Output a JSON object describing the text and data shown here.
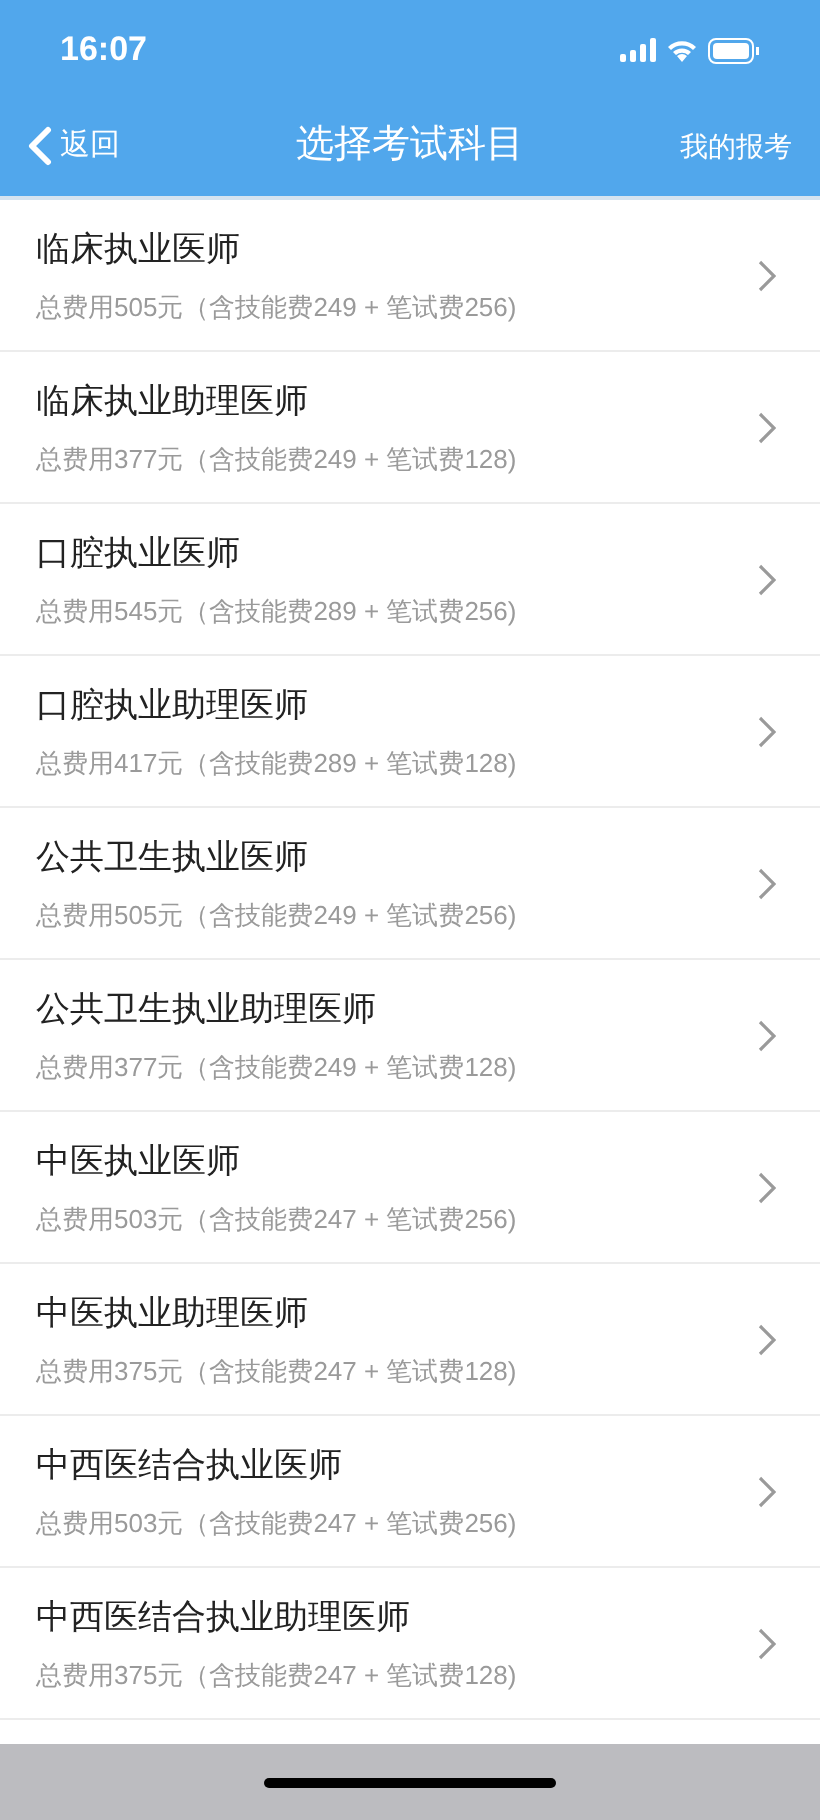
{
  "status_bar": {
    "time": "16:07"
  },
  "nav": {
    "back": "返回",
    "title": "选择考试科目",
    "action": "我的报考"
  },
  "subjects": [
    {
      "name": "临床执业医师",
      "fee": "总费用505元（含技能费249 + 笔试费256)"
    },
    {
      "name": "临床执业助理医师",
      "fee": "总费用377元（含技能费249 + 笔试费128)"
    },
    {
      "name": "口腔执业医师",
      "fee": "总费用545元（含技能费289 + 笔试费256)"
    },
    {
      "name": "口腔执业助理医师",
      "fee": "总费用417元（含技能费289 + 笔试费128)"
    },
    {
      "name": "公共卫生执业医师",
      "fee": "总费用505元（含技能费249 + 笔试费256)"
    },
    {
      "name": "公共卫生执业助理医师",
      "fee": "总费用377元（含技能费249 + 笔试费128)"
    },
    {
      "name": "中医执业医师",
      "fee": "总费用503元（含技能费247 + 笔试费256)"
    },
    {
      "name": "中医执业助理医师",
      "fee": "总费用375元（含技能费247 + 笔试费128)"
    },
    {
      "name": "中西医结合执业医师",
      "fee": "总费用503元（含技能费247 + 笔试费256)"
    },
    {
      "name": "中西医结合执业助理医师",
      "fee": "总费用375元（含技能费247 + 笔试费128)"
    }
  ]
}
